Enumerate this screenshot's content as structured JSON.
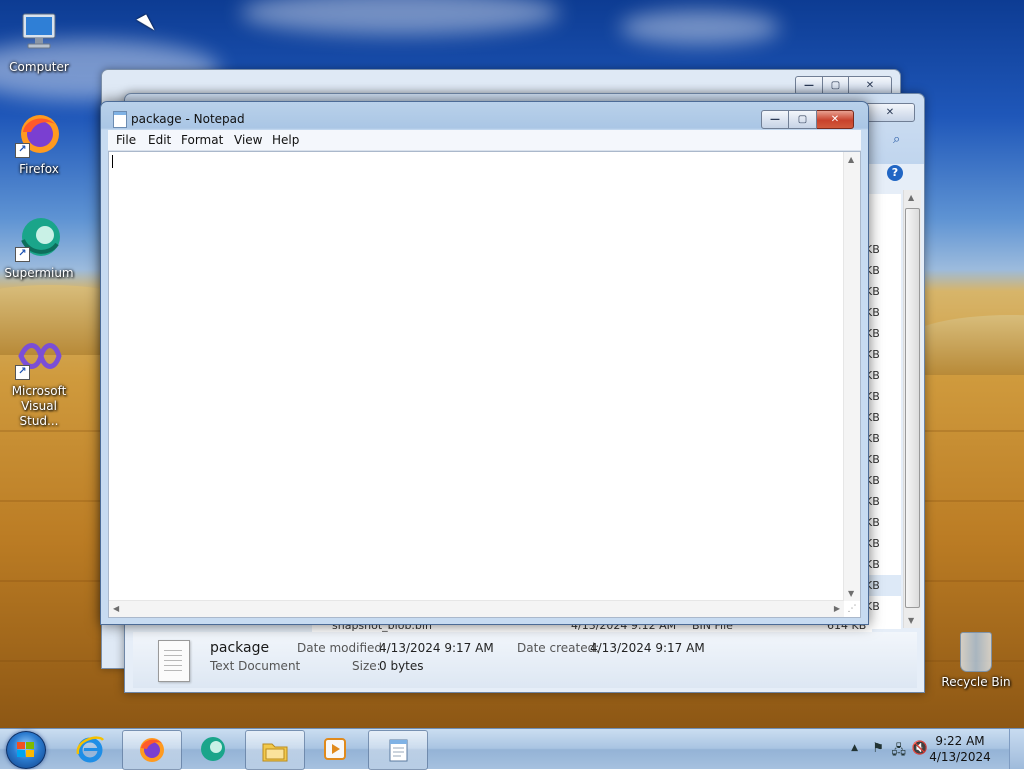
{
  "desktop": {
    "icons": [
      {
        "label": "Computer",
        "icon": "computer-icon"
      },
      {
        "label": "Firefox",
        "icon": "firefox-icon"
      },
      {
        "label": "Supermium",
        "icon": "supermium-icon"
      },
      {
        "label": "Microsoft Visual Stud...",
        "icon": "visual-studio-icon"
      }
    ],
    "recycle_bin": "Recycle Bin"
  },
  "explorer": {
    "sizes": [
      "KB",
      "KB",
      "KB",
      "KB",
      "KB",
      "KB",
      "KB",
      "KB",
      "KB",
      "KB",
      "KB",
      "KB",
      "KB",
      "KB",
      "KB",
      "KB",
      "KB",
      "KB"
    ],
    "partial_row": {
      "name": "snapshot_blob.bin",
      "date": "4/13/2024 9:12 AM",
      "type": "BIN File",
      "size": "614 KB"
    },
    "details": {
      "name": "package",
      "type": "Text Document",
      "date_modified_label": "Date modified:",
      "date_modified": "4/13/2024 9:17 AM",
      "size_label": "Size:",
      "size": "0 bytes",
      "date_created_label": "Date created:",
      "date_created": "4/13/2024 9:17 AM"
    }
  },
  "notepad": {
    "title": "package - Notepad",
    "menu": [
      "File",
      "Edit",
      "Format",
      "View",
      "Help"
    ],
    "content": ""
  },
  "taskbar": {
    "items": [
      {
        "name": "internet-explorer",
        "icon": "internet-explorer-icon"
      },
      {
        "name": "firefox",
        "icon": "firefox-icon"
      },
      {
        "name": "supermium",
        "icon": "supermium-icon"
      },
      {
        "name": "windows-explorer",
        "icon": "folder-icon"
      },
      {
        "name": "media-player",
        "icon": "media-player-icon"
      },
      {
        "name": "notepad",
        "icon": "notepad-icon"
      }
    ],
    "time": "9:22 AM",
    "date": "4/13/2024"
  },
  "colors": {
    "accent": "#2c7cd0",
    "close_red": "#c8422c",
    "titlebar": "#b9d1ea"
  }
}
